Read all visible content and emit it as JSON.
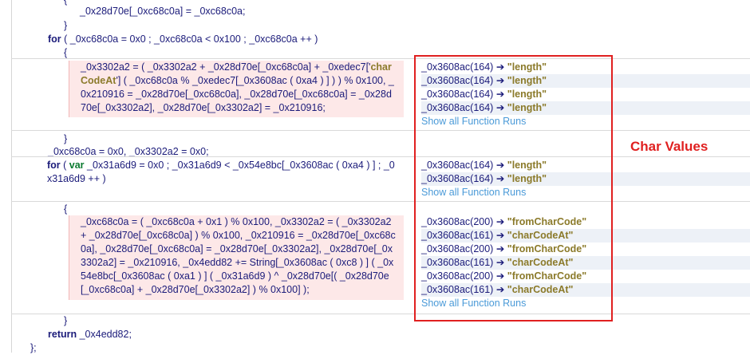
{
  "code": {
    "l1": "_0x28d70e[_0xc68c0a] = _0xc68c0a;",
    "l2": "}",
    "l3_kw": "for",
    "l3": " ( _0xc68c0a = 0x0 ; _0xc68c0a < 0x100 ; _0xc68c0a ++ )",
    "l4": "{",
    "b1_a": "_0x3302a2 = ( _0x3302a2 + _0x28d70e[_0xc68c0a] + _0xedec7['",
    "b1_s": "charCodeAt",
    "b1_b": "'] ( _0xc68c0a % _0xedec7[_0x3608ac ( 0xa4 ) ] ) ) % 0x100, _0x210916 = _0x28d70e[_0xc68c0a], _0x28d70e[_0xc68c0a] = _0x28d70e[_0x3302a2], _0x28d70e[_0x3302a2] = _0x210916;",
    "l5": "}",
    "l6": "_0xc68c0a = 0x0, _0x3302a2 = 0x0;",
    "l7_kw": "for",
    "l7_var": "var",
    "l7": "_0x31a6d9 = 0x0 ; _0x31a6d9 < _0x54e8bc[_0x3608ac ( 0xa4 ) ] ; _0x31a6d9 ++ )",
    "l8": "{",
    "b2": "_0xc68c0a = ( _0xc68c0a + 0x1 ) % 0x100, _0x3302a2 = ( _0x3302a2 + _0x28d70e[_0xc68c0a] ) % 0x100, _0x210916 = _0x28d70e[_0xc68c0a], _0x28d70e[_0xc68c0a] = _0x28d70e[_0x3302a2], _0x28d70e[_0x3302a2] = _0x210916, _0x4edd82 += String[_0x3608ac ( 0xc8 ) ] ( _0x54e8bc[_0x3608ac ( 0xa1 ) ] ( _0x31a6d9 ) ^ _0x28d70e[( _0x28d70e[_0xc68c0a] + _0x28d70e[_0x3302a2] ) % 0x100] );",
    "l9": "}",
    "l10_kw": "return",
    "l10": " _0x4edd82;",
    "l11": "};"
  },
  "runs": {
    "group1": [
      {
        "call": "_0x3608ac(164) ➔ ",
        "val": "\"length\""
      },
      {
        "call": "_0x3608ac(164) ➔ ",
        "val": "\"length\""
      },
      {
        "call": "_0x3608ac(164) ➔ ",
        "val": "\"length\""
      },
      {
        "call": "_0x3608ac(164) ➔ ",
        "val": "\"length\""
      }
    ],
    "group2": [
      {
        "call": "_0x3608ac(164) ➔ ",
        "val": "\"length\""
      },
      {
        "call": "_0x3608ac(164) ➔ ",
        "val": "\"length\""
      }
    ],
    "group3": [
      {
        "call": "_0x3608ac(200) ➔ ",
        "val": "\"fromCharCode\""
      },
      {
        "call": "_0x3608ac(161) ➔ ",
        "val": "\"charCodeAt\""
      },
      {
        "call": "_0x3608ac(200) ➔ ",
        "val": "\"fromCharCode\""
      },
      {
        "call": "_0x3608ac(161) ➔ ",
        "val": "\"charCodeAt\""
      },
      {
        "call": "_0x3608ac(200) ➔ ",
        "val": "\"fromCharCode\""
      },
      {
        "call": "_0x3608ac(161) ➔ ",
        "val": "\"charCodeAt\""
      }
    ],
    "show_all": "Show all Function Runs"
  },
  "annotation": "Char Values",
  "colors": {
    "annotation": "#e02020",
    "string": "#8b7a2a",
    "link": "#4a9ad8",
    "highlight": "#fde8e8"
  }
}
